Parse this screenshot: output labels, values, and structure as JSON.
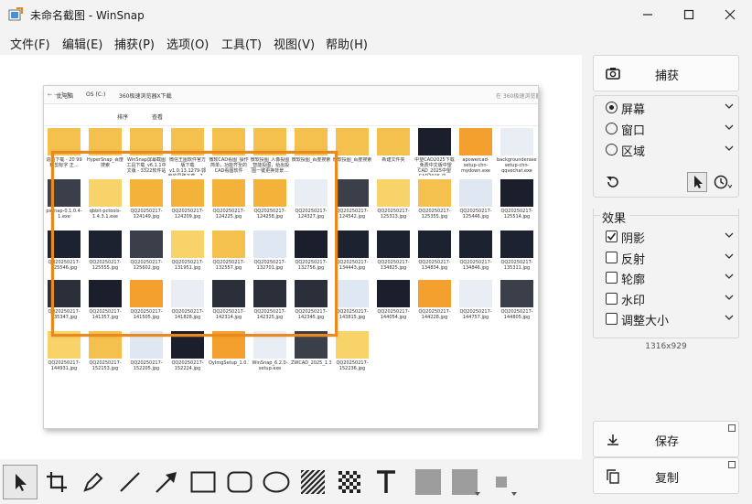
{
  "window": {
    "title": "未命名截图 - WinSnap"
  },
  "menu": [
    "文件(F)",
    "编辑(E)",
    "捕获(P)",
    "选项(O)",
    "工具(T)",
    "视图(V)",
    "帮助(H)"
  ],
  "screenshot": {
    "breadcrumb": [
      "此电脑",
      "OS (C:)",
      "360极速浏览器X下载"
    ],
    "search_placeholder": "在 360极速浏览器X下载",
    "toolbar_labels": [
      "排序",
      "查看"
    ],
    "rows": [
      [
        "造图下载 - 20 99精剪标字 正...",
        "HyperSnap_百度搜索",
        "WinSnap屏幕截图工具下载_v6.1.1中文版 - 3322软件站",
        "微信王图软件官方版下载 v1.0.13.1279-郭安的思路下载 - 2...",
        "微软CAD看图_操作简单，功能齐全的CAD看图软件",
        "微软投图_人像投图_智能投图，给出投图一键更换背景...",
        "微软投图_百度搜索",
        "微软投图_百度搜索",
        "新建文件夹",
        "中望CAD2025下载_免费中文版中望CAD_2025中望CAD2025 中...",
        "apowercad-setup-chn-mydown.exe",
        "backgrounderaser-setup-chn-qqvechat.exe"
      ],
      [
        "pxsnap-0.1.0.4-1.exe",
        "qbbit-pctools-1.4.3.1.exe",
        "QQ20250217-124149.jpg",
        "QQ20250217-124209.jpg",
        "QQ20250217-124225.jpg",
        "QQ20250217-124258.jpg",
        "QQ20250217-124327.jpg",
        "QQ20250217-124542.jpg",
        "QQ20250217-125313.jpg",
        "QQ20250217-125355.jpg",
        "QQ20250217-125446.jpg",
        "QQ20250217-125514.jpg"
      ],
      [
        "QQ20250217-125546.jpg",
        "QQ20250217-125555.jpg",
        "QQ20250217-125602.jpg",
        "QQ20250217-131951.jpg",
        "QQ20250217-132557.jpg",
        "QQ20250217-132701.jpg",
        "QQ20250217-132756.jpg",
        "QQ20250217-134443.jpg",
        "QQ20250217-134825.jpg",
        "QQ20250217-134834.jpg",
        "QQ20250217-134846.jpg",
        "QQ20250217-135311.jpg"
      ],
      [
        "QQ20250217-135347.jpg",
        "QQ20250217-141357.jpg",
        "QQ20250217-141505.jpg",
        "QQ20250217-141828.jpg",
        "QQ20250217-142314.jpg",
        "QQ20250217-142325.jpg",
        "QQ20250217-142345.jpg",
        "QQ20250217-143815.jpg",
        "QQ20250217-144054.jpg",
        "QQ20250217-144228.jpg",
        "QQ20250217-144757.jpg",
        "QQ20250217-144805.jpg"
      ],
      [
        "QQ20250217-144931.jpg",
        "QQ20250217-152153.jpg",
        "QQ20250217-152205.jpg",
        "QQ20250217-152224.jpg",
        "QyImgSetup_1.0.15.1393.exe",
        "WinSnap_6.2.0-setup.exe",
        "ZWCAD_2025_1.3_Chs_Win_64bit.25.0.207.1621.6.exe",
        "QQ20250217-152236.jpg"
      ]
    ]
  },
  "side": {
    "capture": "捕获",
    "modes": [
      "屏幕",
      "窗口",
      "区域"
    ],
    "selected_mode": "屏幕",
    "effects_title": "效果",
    "effects": [
      {
        "label": "阴影",
        "checked": true
      },
      {
        "label": "反射",
        "checked": false
      },
      {
        "label": "轮廓",
        "checked": false
      },
      {
        "label": "水印",
        "checked": false
      },
      {
        "label": "调整大小",
        "checked": false
      }
    ],
    "size": "1316x929",
    "save": "保存",
    "copy": "复制"
  },
  "colors": {
    "accent_selection": "#e88a1f",
    "folder": "#f4c04e"
  }
}
